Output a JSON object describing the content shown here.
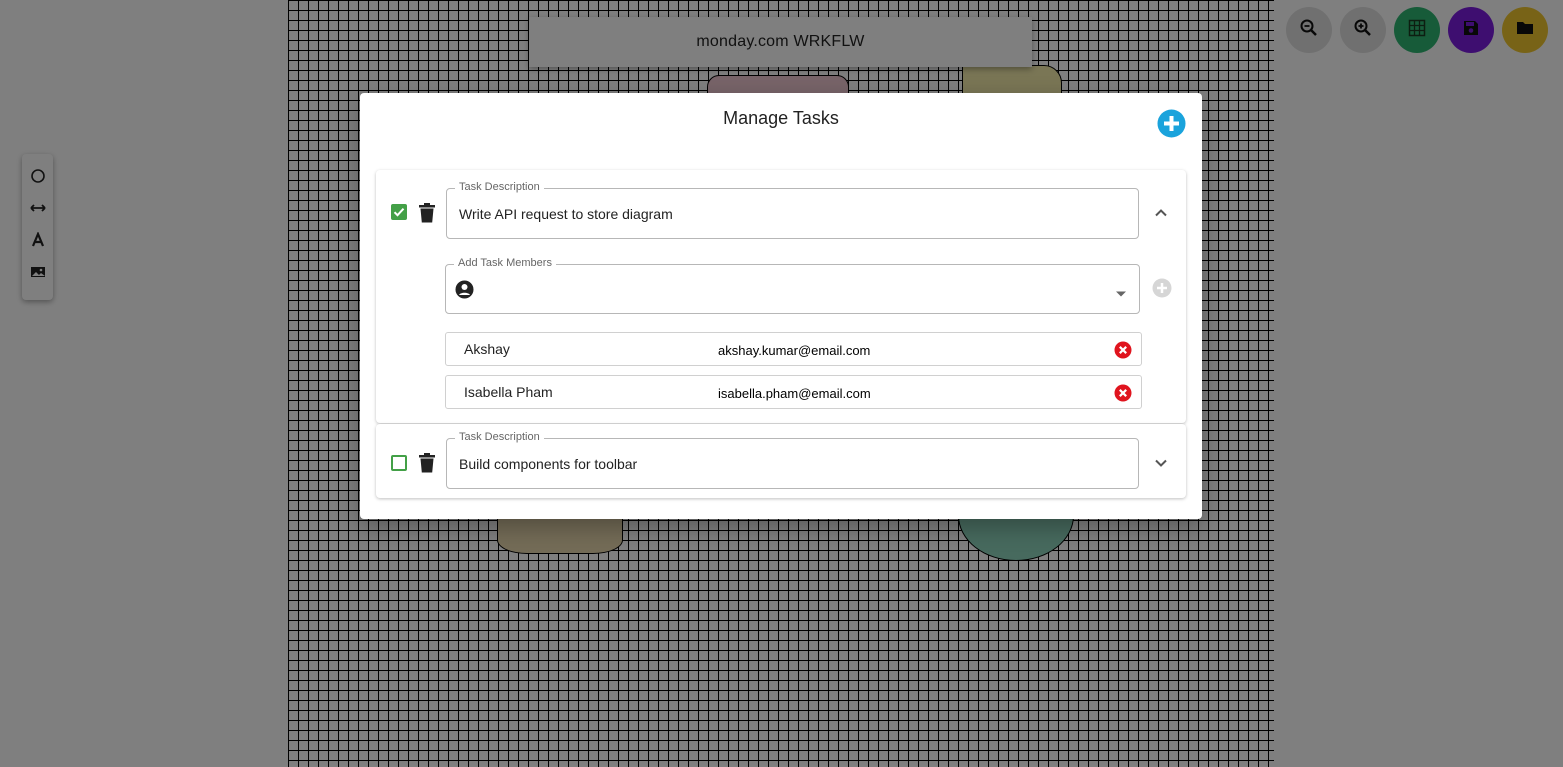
{
  "app": {
    "title": "monday.com WRKFLW"
  },
  "toolbar_left": {
    "tools": [
      "circle-tool",
      "arrow-tool",
      "text-tool",
      "image-tool"
    ]
  },
  "top_actions": [
    "zoom-out",
    "zoom-in",
    "grid",
    "save",
    "open-folder"
  ],
  "colors": {
    "grid_button": "#2fb673",
    "save_button": "#7c1de0",
    "folder_button": "#f1c72e",
    "add_task_button": "#1aa3dc",
    "checkbox": "#43a047",
    "remove_member": "#e0141e"
  },
  "modal": {
    "title": "Manage Tasks",
    "tasks": [
      {
        "completed": true,
        "field_label": "Task Description",
        "description": "Write API request to store diagram",
        "expanded": true,
        "members_field_label": "Add Task Members",
        "members": [
          {
            "name": "Akshay",
            "email": "akshay.kumar@email.com"
          },
          {
            "name": "Isabella Pham",
            "email": "isabella.pham@email.com"
          }
        ]
      },
      {
        "completed": false,
        "field_label": "Task Description",
        "description": "Build components for toolbar",
        "expanded": false
      }
    ]
  }
}
